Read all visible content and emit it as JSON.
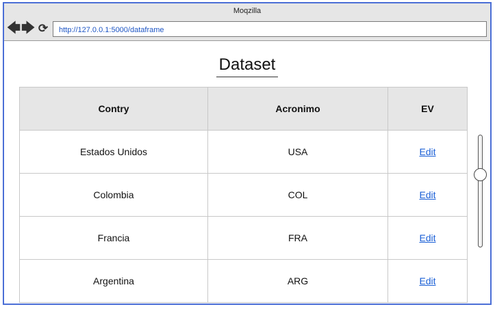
{
  "window": {
    "title": "Moqzilla",
    "url": "http://127.0.0.1:5000/dataframe"
  },
  "page": {
    "heading": "Dataset"
  },
  "table": {
    "headers": [
      "Contry",
      "Acronimo",
      "EV"
    ],
    "rows": [
      {
        "country": "Estados Unidos",
        "acronym": "USA",
        "action": "Edit"
      },
      {
        "country": "Colombia",
        "acronym": "COL",
        "action": "Edit"
      },
      {
        "country": "Francia",
        "acronym": "FRA",
        "action": "Edit"
      },
      {
        "country": "Argentina",
        "acronym": "ARG",
        "action": "Edit"
      }
    ]
  },
  "slider": {
    "orientation": "vertical",
    "value_fraction": 0.35
  },
  "icons": {
    "back": "arrow-left-icon",
    "forward": "arrow-right-icon",
    "reload": "reload-icon"
  },
  "colors": {
    "window_border": "#4a6ed6",
    "chrome_bg": "#e6e6e6",
    "link": "#1a5fd6"
  }
}
